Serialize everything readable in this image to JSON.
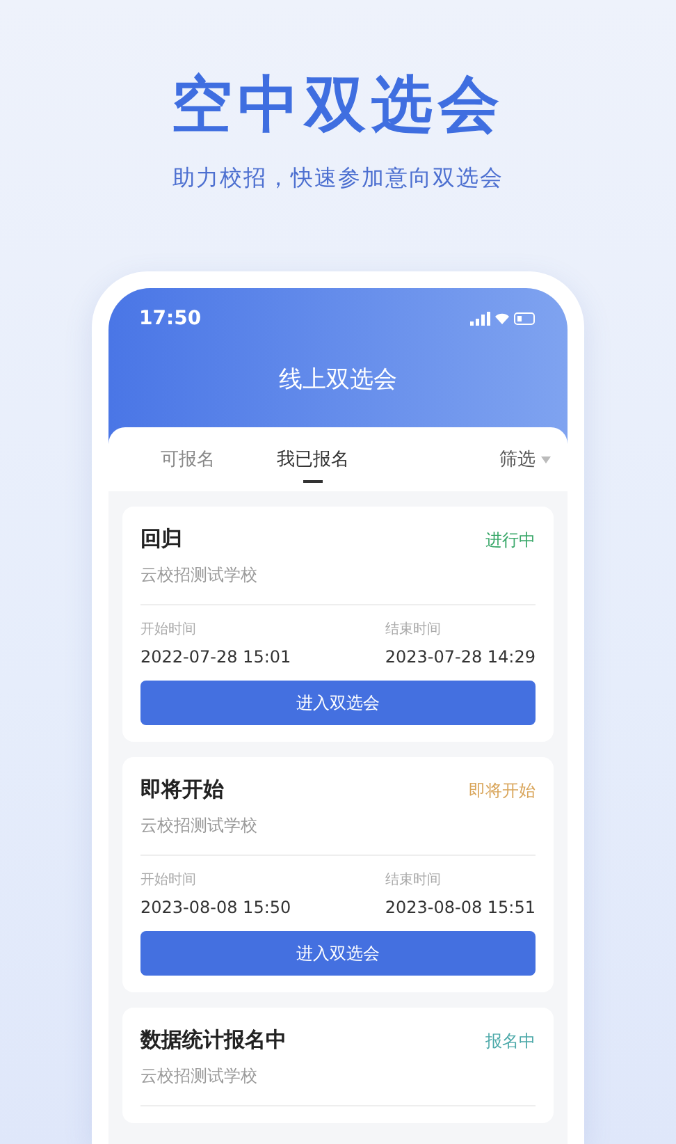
{
  "headline": "空中双选会",
  "subtitle": "助力校招，快速参加意向双选会",
  "phone": {
    "time": "17:50",
    "title": "线上双选会",
    "tabs": [
      {
        "label": "可报名",
        "selected": false
      },
      {
        "label": "我已报名",
        "selected": true
      }
    ],
    "filter": "筛选",
    "cards": [
      {
        "title": "回归",
        "school": "云校招测试学校",
        "status": "进行中",
        "color": "#3aa86a",
        "start_label": "开始时间",
        "start": "2022-07-28 15:01",
        "end_label": "结束时间",
        "end": "2023-07-28 14:29",
        "button": "进入双选会"
      },
      {
        "title": "即将开始",
        "school": "云校招测试学校",
        "status": "即将开始",
        "color": "#d9a55a",
        "start_label": "开始时间",
        "start": "2023-08-08 15:50",
        "end_label": "结束时间",
        "end": "2023-08-08 15:51",
        "button": "进入双选会"
      },
      {
        "title": "数据统计报名中",
        "school": "云校招测试学校",
        "status": "报名中",
        "color": "#4aa8a8"
      }
    ]
  }
}
